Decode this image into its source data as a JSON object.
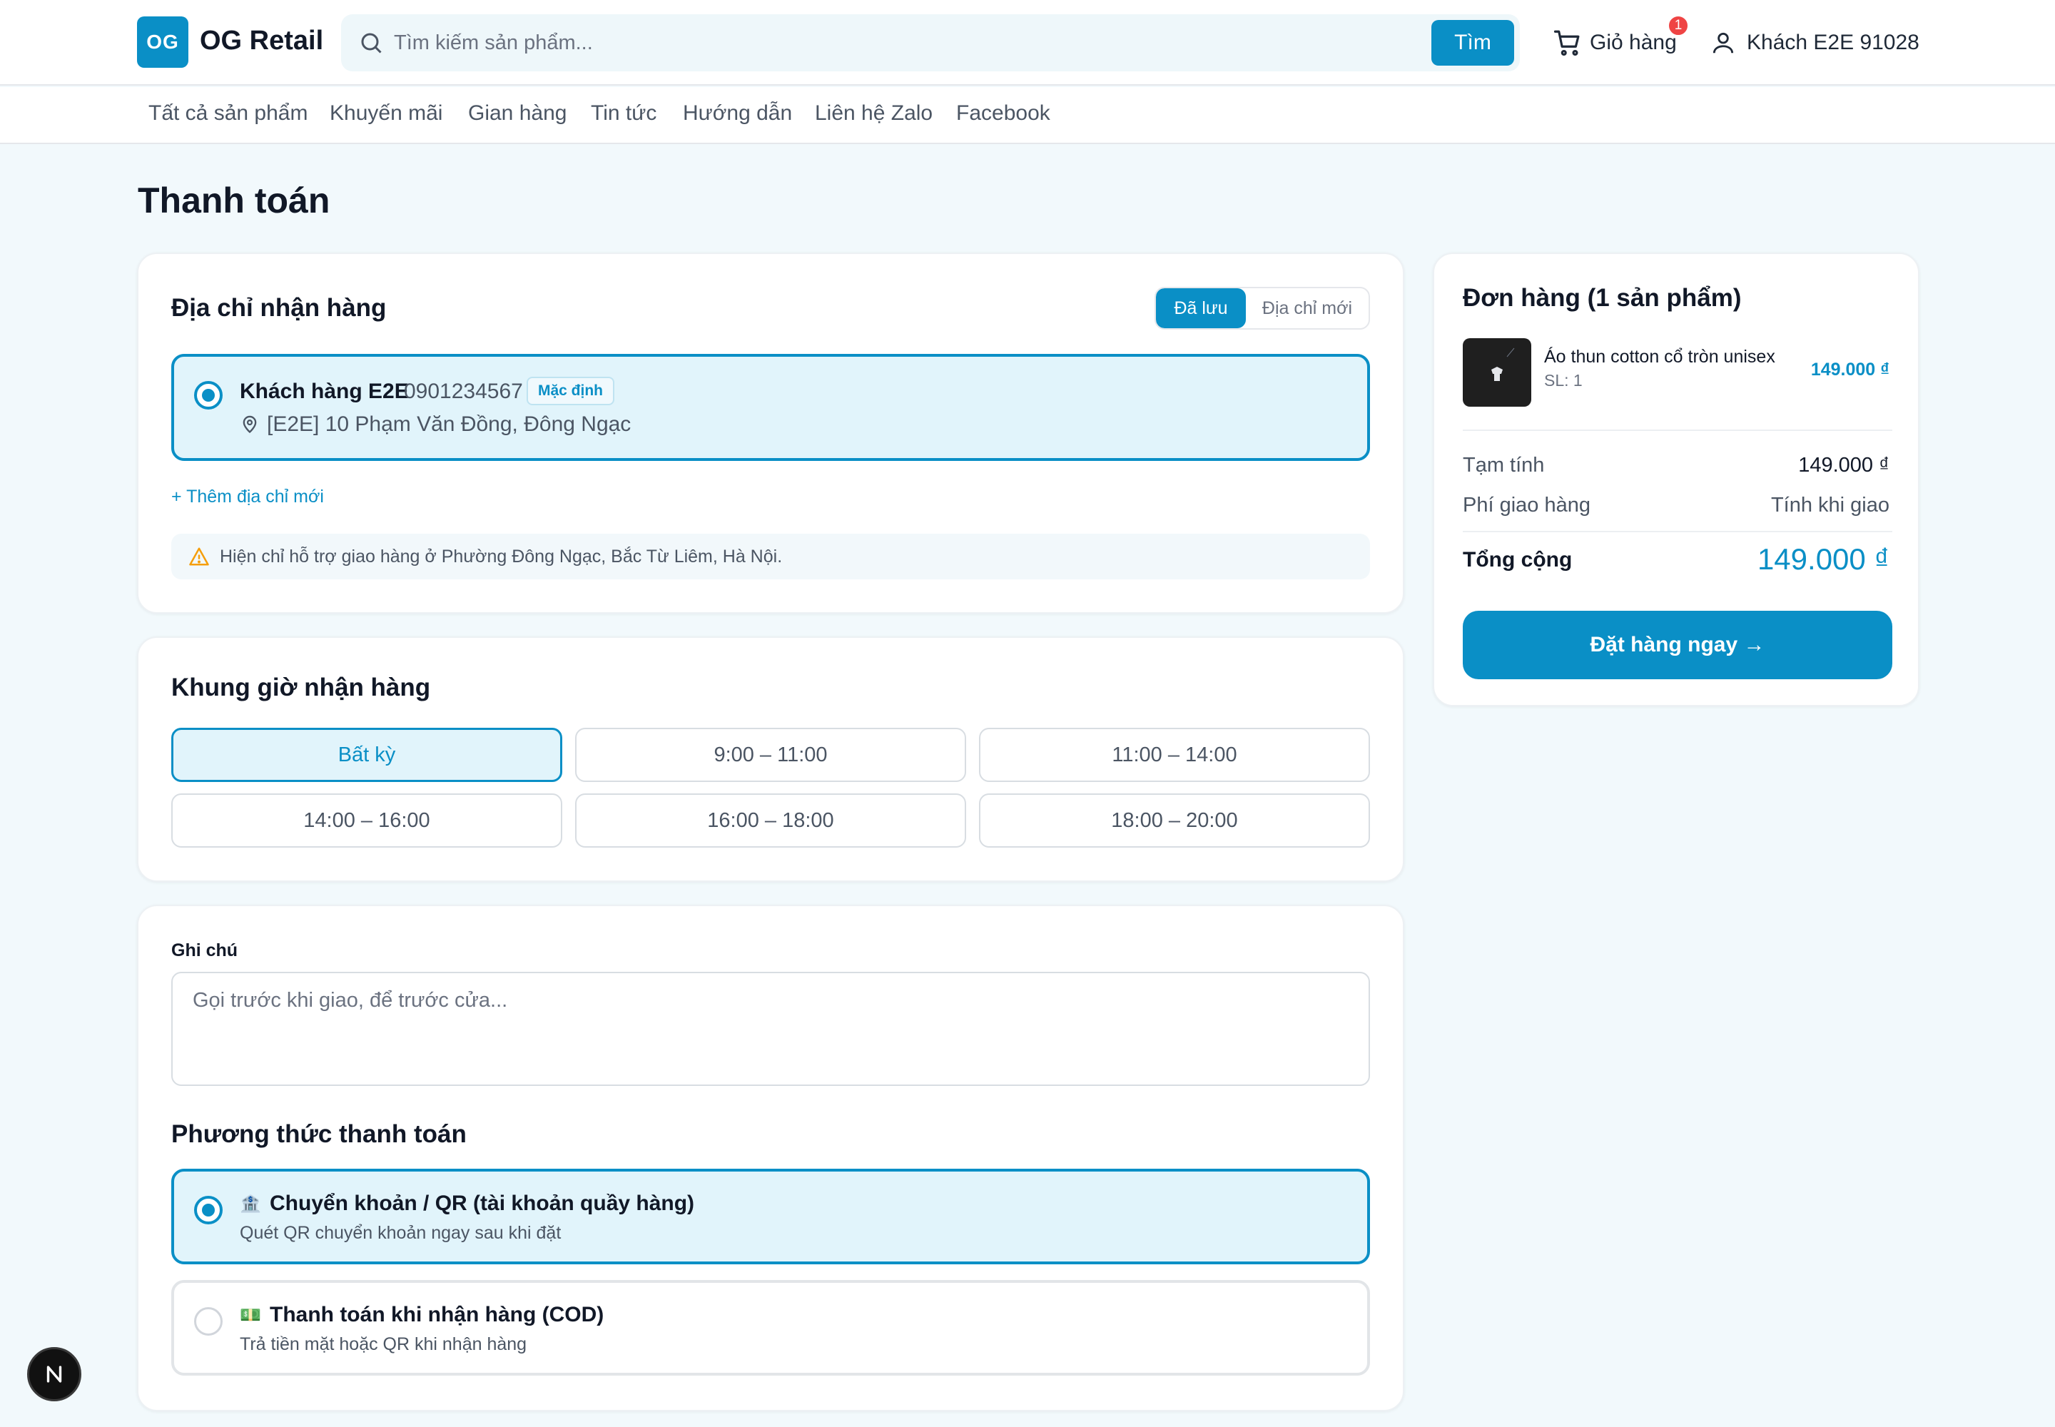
{
  "header": {
    "logo_mark": "OG",
    "logo_text": "OG Retail",
    "search_placeholder": "Tìm kiếm sản phẩm...",
    "search_button": "Tìm",
    "cart_label": "Giỏ hàng",
    "cart_count": "1",
    "user_label": "Khách E2E 91028"
  },
  "nav": [
    "Tất cả sản phẩm",
    "Khuyến mãi",
    "Gian hàng",
    "Tin tức",
    "Hướng dẫn",
    "Liên hệ Zalo",
    "Facebook"
  ],
  "page_title": "Thanh toán",
  "address": {
    "title": "Địa chỉ nhận hàng",
    "toggle_saved": "Đã lưu",
    "toggle_new": "Địa chỉ mới",
    "name": "Khách hàng E2E",
    "phone": "0901234567",
    "default_badge": "Mặc định",
    "line": "[E2E] 10 Phạm Văn Đồng, Đông Ngạc",
    "add_link": "+ Thêm địa chỉ mới",
    "notice": "Hiện chỉ hỗ trợ giao hàng ở Phường Đông Ngạc, Bắc Từ Liêm, Hà Nội."
  },
  "timeslots": {
    "title": "Khung giờ nhận hàng",
    "slots": [
      "Bất kỳ",
      "9:00 – 11:00",
      "11:00 – 14:00",
      "14:00 – 16:00",
      "16:00 – 18:00",
      "18:00 – 20:00"
    ],
    "selected": "Bất kỳ"
  },
  "note": {
    "label": "Ghi chú",
    "placeholder": "Gọi trước khi giao, để trước cửa..."
  },
  "payment": {
    "title": "Phương thức thanh toán",
    "options": [
      {
        "icon": "bank-icon",
        "title": "Chuyển khoản / QR (tài khoản quầy hàng)",
        "subtitle": "Quét QR chuyển khoản ngay sau khi đặt",
        "selected": true
      },
      {
        "icon": "cash-icon",
        "title": "Thanh toán khi nhận hàng (COD)",
        "subtitle": "Trả tiền mặt hoặc QR khi nhận hàng",
        "selected": false
      }
    ]
  },
  "summary": {
    "title": "Đơn hàng (1 sản phẩm)",
    "product_name": "Áo thun cotton cổ tròn unisex",
    "product_qty": "SL: 1",
    "product_price": "149.000 ₫",
    "subtotal_label": "Tạm tính",
    "subtotal_value": "149.000 ₫",
    "shipping_label": "Phí giao hàng",
    "shipping_value": "Tính khi giao",
    "total_label": "Tổng cộng",
    "total_value": "149.000 ₫",
    "order_button": "Đặt hàng ngay →"
  },
  "colors": {
    "accent": "#0a8fc6",
    "background": "#f2f9fc",
    "badge": "#ef4444"
  }
}
